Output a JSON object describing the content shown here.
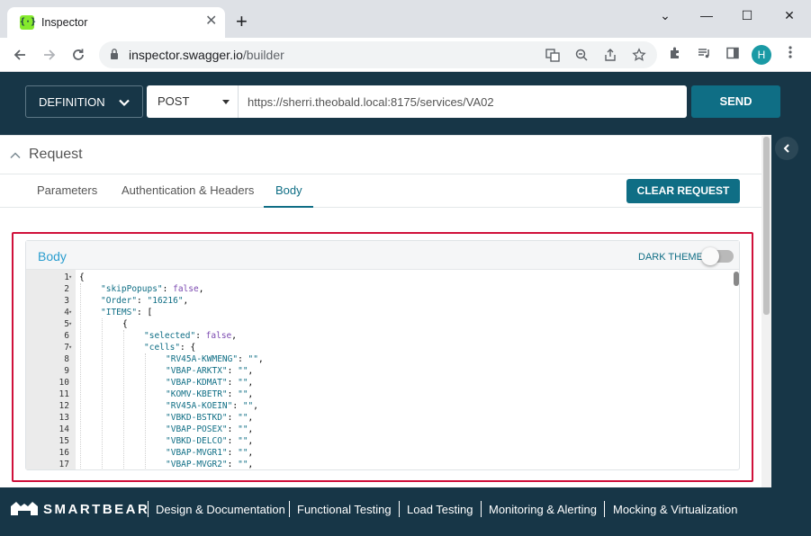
{
  "browser": {
    "tab_title": "Inspector",
    "tab_close": "✕",
    "new_tab": "+",
    "url_host": "inspector.swagger.io",
    "url_path": "/builder",
    "avatar_letter": "H",
    "window_minimize": "—",
    "window_restore": "☐",
    "window_close": "✕",
    "tab_list": "⌄"
  },
  "header": {
    "definition_label": "DEFINITION",
    "method": "POST",
    "url": "https://sherri.theobald.local:8175/services/VA02",
    "send_label": "SEND"
  },
  "request": {
    "title": "Request",
    "tabs": [
      {
        "label": "Parameters"
      },
      {
        "label": "Authentication & Headers"
      },
      {
        "label": "Body"
      }
    ],
    "active_tab": "Body",
    "clear_label": "CLEAR REQUEST",
    "body_panel_title": "Body",
    "dark_theme_label": "DARK THEME",
    "dark_theme_on": false
  },
  "editor": {
    "lines": [
      {
        "n": "1",
        "fold": true,
        "indent": 0,
        "parts": [
          [
            "p",
            "{"
          ]
        ]
      },
      {
        "n": "2",
        "fold": false,
        "indent": 1,
        "parts": [
          [
            "k",
            "\"skipPopups\""
          ],
          [
            "p",
            ": "
          ],
          [
            "w",
            "false"
          ],
          [
            "p",
            ","
          ]
        ]
      },
      {
        "n": "3",
        "fold": false,
        "indent": 1,
        "parts": [
          [
            "k",
            "\"Order\""
          ],
          [
            "p",
            ": "
          ],
          [
            "s",
            "\"16216\""
          ],
          [
            "p",
            ","
          ]
        ]
      },
      {
        "n": "4",
        "fold": true,
        "indent": 1,
        "parts": [
          [
            "k",
            "\"ITEMS\""
          ],
          [
            "p",
            ": ["
          ]
        ]
      },
      {
        "n": "5",
        "fold": true,
        "indent": 2,
        "parts": [
          [
            "p",
            "{"
          ]
        ]
      },
      {
        "n": "6",
        "fold": false,
        "indent": 3,
        "parts": [
          [
            "k",
            "\"selected\""
          ],
          [
            "p",
            ": "
          ],
          [
            "w",
            "false"
          ],
          [
            "p",
            ","
          ]
        ]
      },
      {
        "n": "7",
        "fold": true,
        "indent": 3,
        "parts": [
          [
            "k",
            "\"cells\""
          ],
          [
            "p",
            ": {"
          ]
        ]
      },
      {
        "n": "8",
        "fold": false,
        "indent": 4,
        "parts": [
          [
            "k",
            "\"RV45A-KWMENG\""
          ],
          [
            "p",
            ": "
          ],
          [
            "s",
            "\"\""
          ],
          [
            "p",
            ","
          ]
        ]
      },
      {
        "n": "9",
        "fold": false,
        "indent": 4,
        "parts": [
          [
            "k",
            "\"VBAP-ARKTX\""
          ],
          [
            "p",
            ": "
          ],
          [
            "s",
            "\"\""
          ],
          [
            "p",
            ","
          ]
        ]
      },
      {
        "n": "10",
        "fold": false,
        "indent": 4,
        "parts": [
          [
            "k",
            "\"VBAP-KDMAT\""
          ],
          [
            "p",
            ": "
          ],
          [
            "s",
            "\"\""
          ],
          [
            "p",
            ","
          ]
        ]
      },
      {
        "n": "11",
        "fold": false,
        "indent": 4,
        "parts": [
          [
            "k",
            "\"KOMV-KBETR\""
          ],
          [
            "p",
            ": "
          ],
          [
            "s",
            "\"\""
          ],
          [
            "p",
            ","
          ]
        ]
      },
      {
        "n": "12",
        "fold": false,
        "indent": 4,
        "parts": [
          [
            "k",
            "\"RV45A-KOEIN\""
          ],
          [
            "p",
            ": "
          ],
          [
            "s",
            "\"\""
          ],
          [
            "p",
            ","
          ]
        ]
      },
      {
        "n": "13",
        "fold": false,
        "indent": 4,
        "parts": [
          [
            "k",
            "\"VBKD-BSTKD\""
          ],
          [
            "p",
            ": "
          ],
          [
            "s",
            "\"\""
          ],
          [
            "p",
            ","
          ]
        ]
      },
      {
        "n": "14",
        "fold": false,
        "indent": 4,
        "parts": [
          [
            "k",
            "\"VBAP-POSEX\""
          ],
          [
            "p",
            ": "
          ],
          [
            "s",
            "\"\""
          ],
          [
            "p",
            ","
          ]
        ]
      },
      {
        "n": "15",
        "fold": false,
        "indent": 4,
        "parts": [
          [
            "k",
            "\"VBKD-DELCO\""
          ],
          [
            "p",
            ": "
          ],
          [
            "s",
            "\"\""
          ],
          [
            "p",
            ","
          ]
        ]
      },
      {
        "n": "16",
        "fold": false,
        "indent": 4,
        "parts": [
          [
            "k",
            "\"VBAP-MVGR1\""
          ],
          [
            "p",
            ": "
          ],
          [
            "s",
            "\"\""
          ],
          [
            "p",
            ","
          ]
        ]
      },
      {
        "n": "17",
        "fold": false,
        "indent": 4,
        "parts": [
          [
            "k",
            "\"VBAP-MVGR2\""
          ],
          [
            "p",
            ": "
          ],
          [
            "s",
            "\"\""
          ],
          [
            "p",
            ","
          ]
        ]
      }
    ]
  },
  "footer": {
    "brand": "SMARTBEAR",
    "links": [
      {
        "label": "Design & Documentation"
      },
      {
        "label": "Functional Testing"
      },
      {
        "label": "Load Testing"
      },
      {
        "label": "Monitoring & Alerting"
      },
      {
        "label": "Mocking & Virtualization"
      }
    ]
  },
  "colors": {
    "header_bg": "#173647",
    "accent": "#0f6e85",
    "highlight": "#d0103a",
    "body_title": "#2a9dcf",
    "swagger_green": "#85ea2d"
  },
  "icons": {
    "favicon": "swagger-icon",
    "back": "arrow-left-icon",
    "forward": "arrow-right-icon",
    "reload": "reload-icon",
    "lock": "lock-icon",
    "translate": "translate-icon",
    "zoom": "zoom-icon",
    "share": "share-icon",
    "bookmark": "star-icon",
    "extensions": "puzzle-icon",
    "media": "media-icon",
    "sidepanel": "sidepanel-icon",
    "menu": "kebab-menu-icon",
    "collapse": "chevron-left-icon",
    "brand_logo": "smartbear-logo-icon"
  }
}
